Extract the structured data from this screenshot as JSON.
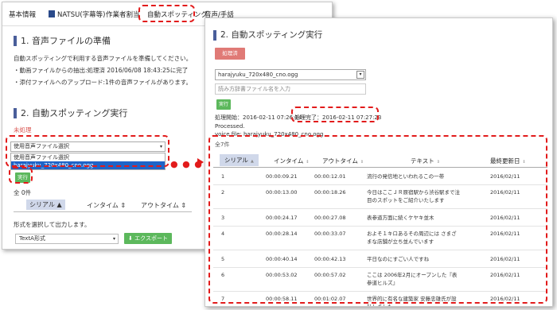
{
  "back": {
    "tabs": [
      {
        "label": "基本情報"
      },
      {
        "label": "NATSU(字幕等)"
      },
      {
        "label": "作業者割当"
      },
      {
        "label": "自動スポッティング"
      },
      {
        "label": "音声/手話"
      }
    ],
    "section1_title": "1. 音声ファイルの準備",
    "section1_desc": "自動スポッティングで利用する音声ファイルを準備してください。",
    "section1_line1": "・動画ファイルからの抽出:処理済 2016/06/08 18:43:25に完了",
    "section1_line2": "・添付ファイルへのアップロード:1件の音声ファイルがあります。",
    "section2_title": "2. 自動スポッティング実行",
    "status": "未処理",
    "select_value": "使用音声ファイル選択",
    "dropdown_options": [
      "使用音声ファイル選択",
      "harajyuku_720x480_cno.ogg"
    ],
    "run_button": "実行",
    "count": "全 0件",
    "columns": [
      "シリアル",
      "インタイム",
      "アウトタイム"
    ],
    "export_desc": "形式を選択して出力します。",
    "export_format": "TextA形式",
    "export_button": "エクスポート"
  },
  "front": {
    "title": "2. 自動スポッティング実行",
    "processed_badge": "処理済",
    "file_select": "harajyuku_720x480_cno.ogg",
    "dict_placeholder": "読み方辞書ファイル名を入力",
    "run_button": "実行",
    "start_label": "処理開始：2016-02-11 07:26:34",
    "done_label": "処理完了：2016-02-11 07:27:23",
    "processed_text": "Processed.",
    "voice_file": "voice file: harajyuku_720x480_cno.ogg",
    "count": "全7件",
    "columns": [
      "シリアル",
      "インタイム",
      "アウトタイム",
      "テキスト",
      "最終更新日"
    ],
    "rows": [
      {
        "serial": "1",
        "in": "00:00:09.21",
        "out": "00:00:12.01",
        "text": "流行の発信地といわれるこの一帯",
        "date": "2016/02/11"
      },
      {
        "serial": "2",
        "in": "00:00:13.00",
        "out": "00:00:18.26",
        "text": "今日はここＪＲ原宿駅から渋谷駅まで注目のスポットをご紹介いたします",
        "date": "2016/02/11"
      },
      {
        "serial": "3",
        "in": "00:00:24.17",
        "out": "00:00:27.08",
        "text": "表参道方面に続くケヤキ並木",
        "date": "2016/02/11"
      },
      {
        "serial": "4",
        "in": "00:00:28.14",
        "out": "00:00:33.07",
        "text": "およそ１キロあるその周辺には さまざまな店舗が立ち並んでいます",
        "date": "2016/02/11"
      },
      {
        "serial": "5",
        "in": "00:00:40.14",
        "out": "00:00:42.13",
        "text": "平日なのにすごい人ですね",
        "date": "2016/02/11"
      },
      {
        "serial": "6",
        "in": "00:00:53.02",
        "out": "00:00:57.02",
        "text": "ここは 2006年2月にオープンした『表参道ヒルズ』",
        "date": "2016/02/11"
      },
      {
        "serial": "7",
        "in": "00:00:58.11",
        "out": "00:01:02.07",
        "text": "世界的に有名な建築家 安藤忠雄氏が設計しました",
        "date": "2016/02/11"
      }
    ]
  },
  "colors": {
    "highlight": "#e21b1b",
    "run_green": "#5cb85c",
    "processed_red": "#e07a76",
    "section_bar": "#4a5e9a"
  }
}
